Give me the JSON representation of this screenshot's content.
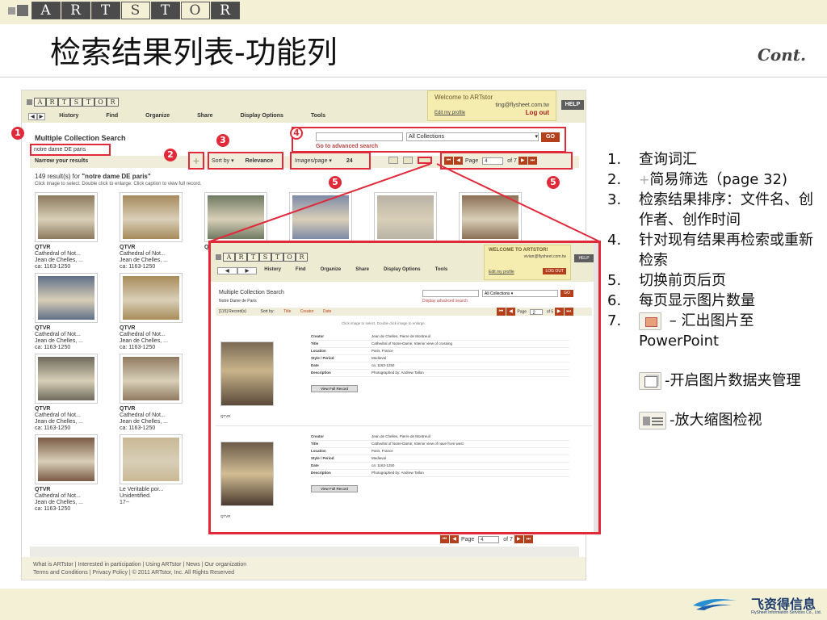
{
  "header": {
    "logo_letters": [
      "A",
      "R",
      "T",
      "S",
      "T",
      "O",
      "R"
    ],
    "title": "检索结果列表-功能列",
    "cont": "Cont."
  },
  "artstor": {
    "nav": [
      "History",
      "Find",
      "Organize",
      "Share",
      "Display Options",
      "Tools"
    ],
    "welcome_title": "Welcome to ARTstor",
    "welcome_email": "ting@flysheet.com.tw",
    "edit_profile": "Edit my profile",
    "logout": "Log out",
    "help": "HELP",
    "collection_heading": "Multiple Collection Search",
    "query": "notre dame DE paris",
    "collection_select": "All Collections",
    "go": "GO",
    "advanced_search": "Go to advanced search",
    "narrow_results": "Narrow your results",
    "sort_label": "Sort by",
    "sort_value": "Relevance",
    "images_per_page_label": "Images/page",
    "images_per_page_value": "24",
    "page_label": "Page",
    "page_value": "4",
    "page_total": "of 7",
    "result_count": "149 result(s) for",
    "result_query": "\"notre dame DE paris\"",
    "result_hint": "Click image to select. Double click to enlarge. Click caption to view full record.",
    "thumbs": [
      {
        "tag": "QTVR",
        "l1": "Cathedral of Not...",
        "l2": "Jean de Chelles, ...",
        "l3": "ca: 1163-1250",
        "color": "#8c7a5e"
      },
      {
        "tag": "QTVR",
        "l1": "Cathedral of Not...",
        "l2": "Jean de Chelles, ...",
        "l3": "ca: 1163-1250",
        "color": "#a68a5c"
      },
      {
        "tag": "QTVR",
        "l1": "",
        "l2": "",
        "l3": "",
        "color": "#6f7a62"
      },
      {
        "tag": "",
        "l1": "",
        "l2": "",
        "l3": "",
        "color": "#7d8aa6"
      },
      {
        "tag": "",
        "l1": "",
        "l2": "",
        "l3": "",
        "color": "#b9b3a6"
      },
      {
        "tag": "",
        "l1": "",
        "l2": "",
        "l3": "",
        "color": "#8a6f55"
      },
      {
        "tag": "QTVR",
        "l1": "Cathedral of Not...",
        "l2": "Jean de Chelles, ...",
        "l3": "ca: 1163-1250",
        "color": "#5f6f88"
      },
      {
        "tag": "QTVR",
        "l1": "Cathedral of Not...",
        "l2": "Jean de Chelles, ...",
        "l3": "ca: 1163-1250",
        "color": "#a88c5a"
      },
      {
        "tag": "QTVR",
        "l1": "Cathedral of Not...",
        "l2": "Jean de Chelles, ...",
        "l3": "ca: 1163-1250",
        "color": "#6e6a5c"
      },
      {
        "tag": "QTVR",
        "l1": "Cathedral of Not...",
        "l2": "Jean de Chelles, ...",
        "l3": "ca: 1163-1250",
        "color": "#8f7a60"
      },
      {
        "tag": "QTVR",
        "l1": "Cathedral of Not...",
        "l2": "Jean de Chelles, ...",
        "l3": "ca: 1163-1250",
        "color": "#7a5a45"
      },
      {
        "tag": "",
        "l1": "Le Veritable por...",
        "l2": "Unidentified.",
        "l3": "17--",
        "color": "#c8b894"
      }
    ],
    "footer_line1": "What is ARTstor  |  Interested in participation  |  Using ARTstor  |  News  |  Our organization",
    "footer_line2": "Terms and Conditions  |  Privacy Policy  |  © 2011 ARTstor, Inc. All Rights Reserved"
  },
  "inset": {
    "welcome_title": "WELCOME TO ARTSTOR!",
    "welcome_email": "vivian@flysheet.com.tw",
    "edit_profile": "Edit my profile",
    "logout": "LOG OUT",
    "help": "HELP",
    "nav": [
      "History",
      "Find",
      "Organize",
      "Share",
      "Display Options",
      "Tools"
    ],
    "collection_heading": "Multiple Collection Search",
    "query": "Notre Dame de Paris",
    "collection_select": "All Collections",
    "go": "GO",
    "advanced_search": "Display advanced search",
    "records": "[115] Record(s)",
    "sort_by": "Sort by:",
    "sort_opts": [
      "Title",
      "Creator",
      "Date"
    ],
    "page_label": "Page",
    "page_value": "2",
    "page_total": "of 5",
    "hint": "Click image to select. Double click image to enlarge.",
    "view_full": "View Full Record",
    "record_tag": "QTVR",
    "record1": [
      {
        "k": "Creator",
        "v": "Jean de Chelles, Pierre de Montreuil"
      },
      {
        "k": "Title",
        "v": "Cathedral of Notre-Dame; Interior view of crossing"
      },
      {
        "k": "Location",
        "v": "Paris, France"
      },
      {
        "k": "Style / Period",
        "v": "Medieval"
      },
      {
        "k": "Date",
        "v": "ca: 1163-1250"
      },
      {
        "k": "Description",
        "v": "Photographed by: Andrew Tallon"
      }
    ],
    "record2": [
      {
        "k": "Creator",
        "v": "Jean de Chelles, Pierre de Montreuil"
      },
      {
        "k": "Title",
        "v": "Cathedral of Notre-Dame; Interior view of nave from west"
      },
      {
        "k": "Location",
        "v": "Paris, France"
      },
      {
        "k": "Style / Period",
        "v": "Medieval"
      },
      {
        "k": "Date",
        "v": "ca: 1163-1250"
      },
      {
        "k": "Description",
        "v": "Photographed by: Andrew Tallon"
      }
    ]
  },
  "markers": [
    "1",
    "2",
    "3",
    "4",
    "5",
    "5"
  ],
  "list": [
    {
      "num": "1.",
      "text": "查询词汇"
    },
    {
      "num": "2.",
      "text": "简易筛选（page 32)"
    },
    {
      "num": "3.",
      "text": "检索结果排序：文件名、创作者、创作时间"
    },
    {
      "num": "4.",
      "text": "针对现有结果再检索或重新检索"
    },
    {
      "num": "5.",
      "text": "切换前页后页"
    },
    {
      "num": "6.",
      "text": "每页显示图片数量"
    },
    {
      "num": "7.",
      "text": " – 汇出图片至PowerPoint"
    }
  ],
  "icon_notes": {
    "folder": "-开启图片数据夹管理",
    "zoom": "-放大缩图检视"
  },
  "brand": {
    "name": "飞资得信息",
    "sub": "FlySheet Information Services Co., Ltd."
  }
}
